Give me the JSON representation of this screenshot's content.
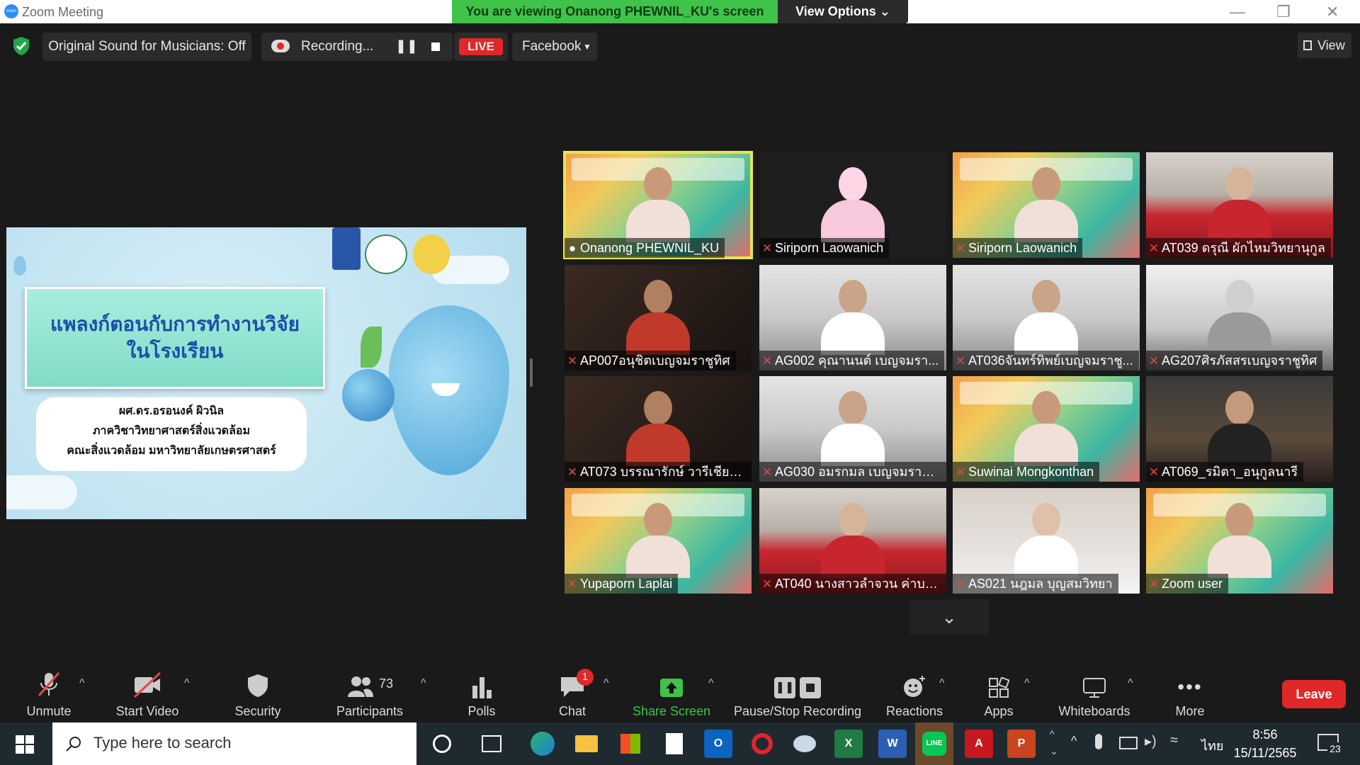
{
  "window": {
    "app_title": "Zoom Meeting",
    "viewing_banner": "You are viewing Onanong PHEWNIL_KU's screen",
    "view_options": "View Options",
    "view_button": "View"
  },
  "top_controls": {
    "original_sound": "Original Sound for Musicians: Off",
    "recording": "Recording...",
    "live_badge": "LIVE",
    "live_platform": "Facebook"
  },
  "shared_slide": {
    "title_line1": "แพลงก์ตอนกับการทำงานวิจัย",
    "title_line2": "ในโรงเรียน",
    "author_line1": "ผศ.ดร.อรอนงค์  ผิวนิล",
    "author_line2": "ภาควิชาวิทยาศาสตร์สิ่งแวดล้อม",
    "author_line3": "คณะสิ่งแวดล้อม มหาวิทยาลัยเกษตรศาสตร์"
  },
  "participants_grid": [
    {
      "name": "Onanong PHEWNIL_KU",
      "muted": false,
      "bg": "conf"
    },
    {
      "name": "Siriporn Laowanich",
      "muted": true,
      "bg": "cartoon"
    },
    {
      "name": "Siriporn Laowanich",
      "muted": true,
      "bg": "conf"
    },
    {
      "name": "AT039 ดรุณี ผักไหมวิทยานุกูล",
      "muted": true,
      "bg": "class"
    },
    {
      "name": "AP007อนุชิตเบญจมราชูทิศ",
      "muted": true,
      "bg": "dark"
    },
    {
      "name": "AG002 คุณานนต์ เบญจมรา...",
      "muted": true,
      "bg": "room"
    },
    {
      "name": "AT036จันทร์ทิพย์เบญจมราชู...",
      "muted": true,
      "bg": "room"
    },
    {
      "name": "AG207ศิรภัสสรเบญจราชูทิศ",
      "muted": true,
      "bg": "ceiling"
    },
    {
      "name": "AT073 บรรณารักษ์ วารีเชียงใ...",
      "muted": true,
      "bg": "dark"
    },
    {
      "name": "AG030 อมรกมล เบญจมราชู...",
      "muted": true,
      "bg": "room"
    },
    {
      "name": "Suwinai Mongkonthan",
      "muted": true,
      "bg": "conf"
    },
    {
      "name": "AT069_รมิตา_อนุกูลนารี",
      "muted": true,
      "bg": "office"
    },
    {
      "name": "Yupaporn Laplai",
      "muted": true,
      "bg": "conf"
    },
    {
      "name": "AT040 นางสาวลำจวน  ค่าบร...",
      "muted": true,
      "bg": "class"
    },
    {
      "name": "AS021 นฎมล บุญสมวิทยา",
      "muted": true,
      "bg": "students"
    },
    {
      "name": "Zoom user",
      "muted": true,
      "bg": "conf"
    }
  ],
  "bottom_toolbar": {
    "unmute": "Unmute",
    "start_video": "Start Video",
    "security": "Security",
    "participants": "Participants",
    "participants_count": "73",
    "polls": "Polls",
    "chat": "Chat",
    "chat_badge": "1",
    "share_screen": "Share Screen",
    "pause_stop_recording": "Pause/Stop Recording",
    "reactions": "Reactions",
    "apps": "Apps",
    "whiteboards": "Whiteboards",
    "more": "More",
    "leave": "Leave"
  },
  "taskbar": {
    "search_placeholder": "Type here to search",
    "language": "ไทย",
    "time": "8:56",
    "date": "15/11/2565",
    "notifications": "23"
  },
  "colors": {
    "accent_green": "#3fc34a",
    "live_red": "#e02828",
    "active_speaker": "#e8e54a"
  }
}
